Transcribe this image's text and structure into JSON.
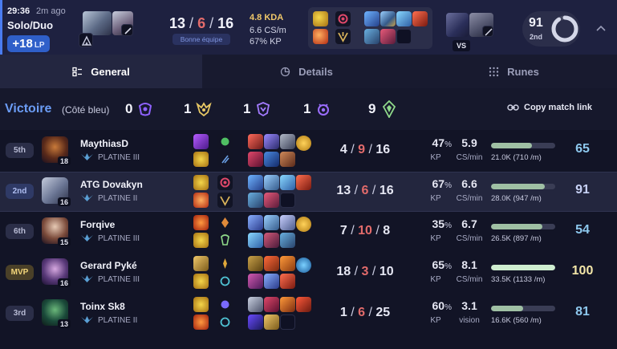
{
  "header": {
    "time": "29:36",
    "ago": "2m ago",
    "queue": "Solo/Duo",
    "lp": "+18",
    "lp_unit": "LP",
    "kills": "13",
    "deaths": "6",
    "assists": "16",
    "badge": "Bonne équipe",
    "kda_ratio": "4.8 KDA",
    "cs_per_min": "6.6 CS/m",
    "kp": "67% KP",
    "vs_label": "VS",
    "score": "91",
    "placement": "2nd",
    "score_progress": 0.91,
    "expand_icon": "chevron-up-icon"
  },
  "tabs": [
    {
      "label": "General",
      "icon": "list-icon",
      "active": true
    },
    {
      "label": "Details",
      "icon": "chart-pie-icon",
      "active": false
    },
    {
      "label": "Runes",
      "icon": "grid-dots-icon",
      "active": false
    }
  ],
  "summary": {
    "result": "Victoire",
    "side": "(Côté bleu)",
    "barons": "0",
    "dragons": "1",
    "heralds": "1",
    "void": "1",
    "towers": "9",
    "copy_link": "Copy match link"
  },
  "players": [
    {
      "placement": "5th",
      "name": "MaythiasD",
      "rank": "PLATINE III",
      "level": "18",
      "kills": "4",
      "deaths": "9",
      "assists": "16",
      "kp": "47",
      "cs": "5.9",
      "cs_label": "CS/min",
      "damage": "21.0K (710 /m)",
      "damage_fraction": 0.64,
      "score": "65"
    },
    {
      "placement": "2nd",
      "name": "ATG Dovakyn",
      "rank": "PLATINE II",
      "level": "16",
      "kills": "13",
      "deaths": "6",
      "assists": "16",
      "kp": "67",
      "cs": "6.6",
      "cs_label": "CS/min",
      "damage": "28.0K (947 /m)",
      "damage_fraction": 0.84,
      "score": "91"
    },
    {
      "placement": "6th",
      "name": "Forqive",
      "rank": "PLATINE III",
      "level": "15",
      "kills": "7",
      "deaths": "10",
      "assists": "8",
      "kp": "35",
      "cs": "6.7",
      "cs_label": "CS/min",
      "damage": "26.5K (897 /m)",
      "damage_fraction": 0.8,
      "score": "54"
    },
    {
      "placement": "MVP",
      "name": "Gerard Pyké",
      "rank": "PLATINE III",
      "level": "16",
      "kills": "18",
      "deaths": "3",
      "assists": "10",
      "kp": "65",
      "cs": "8.1",
      "cs_label": "CS/min",
      "damage": "33.5K (1133 /m)",
      "damage_fraction": 1.0,
      "score": "100"
    },
    {
      "placement": "3rd",
      "name": "Toinx Sk8",
      "rank": "PLATINE II",
      "level": "13",
      "kills": "1",
      "deaths": "6",
      "assists": "25",
      "kp": "60",
      "cs": "3.1",
      "cs_label": "vision",
      "damage": "16.6K (560 /m)",
      "damage_fraction": 0.5,
      "score": "81"
    }
  ],
  "labels": {
    "kp_label": "KP",
    "percent": "%",
    "slash": "/"
  },
  "colors": {
    "accent_blue": "#4a7cf0",
    "victory_blue": "#6b9cf5",
    "death_red": "#e26b6b",
    "mvp_gold": "#f3e6a8",
    "score_blue": "#8ec9ef",
    "lp_badge": "#2f5fc9"
  }
}
